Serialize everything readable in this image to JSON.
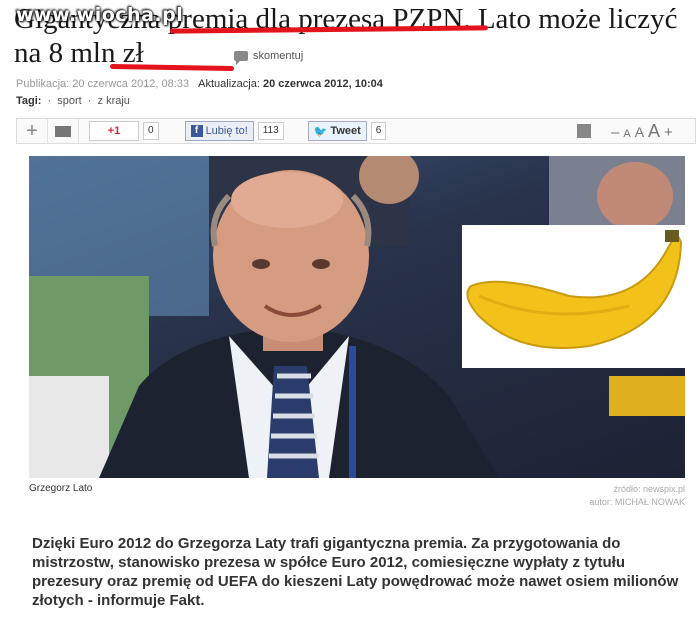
{
  "article": {
    "headline": "Gigantyczna premia dla prezesa PZPN. Lato może liczyć na 8 mln zł",
    "watermark": "www.wiocha.pl",
    "comment_label": "skomentuj",
    "meta": {
      "published_label": "Publikacja:",
      "published_value": "20 czerwca 2012, 08:33",
      "updated_label": "Aktualizacja:",
      "updated_value": "20 czerwca 2012, 10:04"
    },
    "tags": {
      "label": "Tagi:",
      "items": [
        "sport",
        "z kraju"
      ]
    },
    "toolbar": {
      "plus_icon": "+",
      "gplus_label": "+1",
      "gplus_count": "0",
      "fb_label": "Lubię to!",
      "fb_count": "113",
      "tweet_label": "Tweet",
      "tweet_count": "6",
      "font_sizes": [
        "–",
        "A",
        "A",
        "A",
        "+"
      ]
    },
    "photo": {
      "caption": "Grzegorz Lato",
      "source": "źródło: newspix.pl",
      "author": "autor: MICHAŁ NOWAK"
    },
    "lead": "Dzięki Euro 2012 do Grzegorza Laty trafi gigantyczna premia. Za przygotowania do mistrzostw, stanowisko prezesa w spółce Euro 2012, comiesięczne wypłaty z tytułu prezesury oraz premię od UEFA do kieszeni Laty powędrować może nawet osiem milionów złotych - informuje Fakt."
  },
  "colors": {
    "underline": "#e3141b",
    "banana": "#f2c21b"
  }
}
